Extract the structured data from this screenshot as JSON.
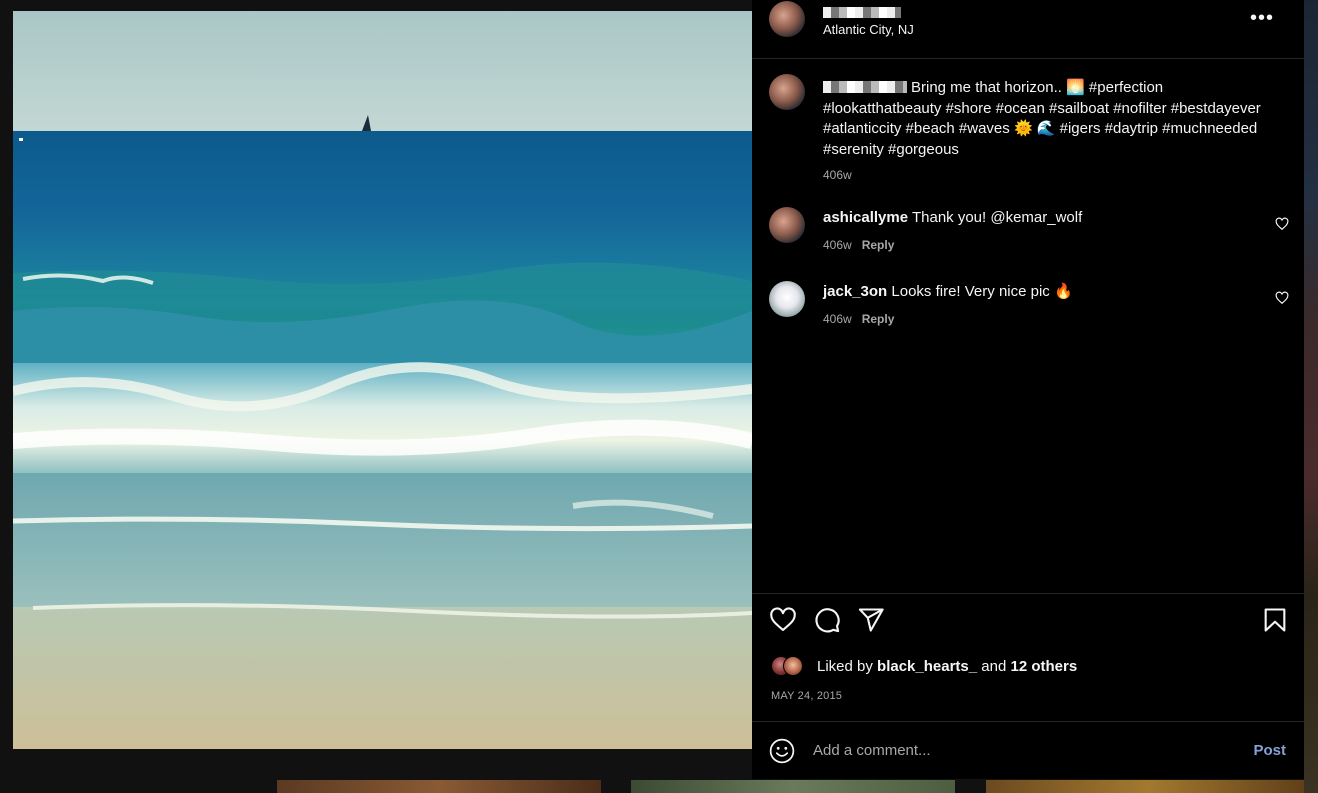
{
  "post": {
    "location": "Atlantic City, NJ",
    "caption": {
      "text": "Bring me that horizon.. 🌅 #perfection #lookatthatbeauty #shore #ocean #sailboat #nofilter #bestdayever #atlanticcity #beach #waves 🌞 🌊 #igers #daytrip #muchneeded #serenity #gorgeous",
      "age": "406w"
    },
    "comments": [
      {
        "user": "ashicallyme",
        "text": "Thank you! @kemar_wolf",
        "age": "406w",
        "reply_label": "Reply"
      },
      {
        "user": "jack_3on",
        "text": "Looks fire! Very nice pic 🔥",
        "age": "406w",
        "reply_label": "Reply"
      }
    ],
    "likes": {
      "prefix": "Liked by",
      "user": "black_hearts_",
      "connector": "and",
      "others": "12 others"
    },
    "date": "MAY 24, 2015"
  },
  "comment_box": {
    "placeholder": "Add a comment...",
    "post_label": "Post"
  },
  "icons": [
    "more-icon",
    "heart-icon",
    "comment-icon",
    "share-icon",
    "bookmark-icon",
    "emoji-icon",
    "small-heart-icon"
  ],
  "colors": {
    "panel_bg": "#000000",
    "muted_text": "#a8a8a8",
    "post_button": "#85a1d6",
    "divider": "#262626"
  }
}
